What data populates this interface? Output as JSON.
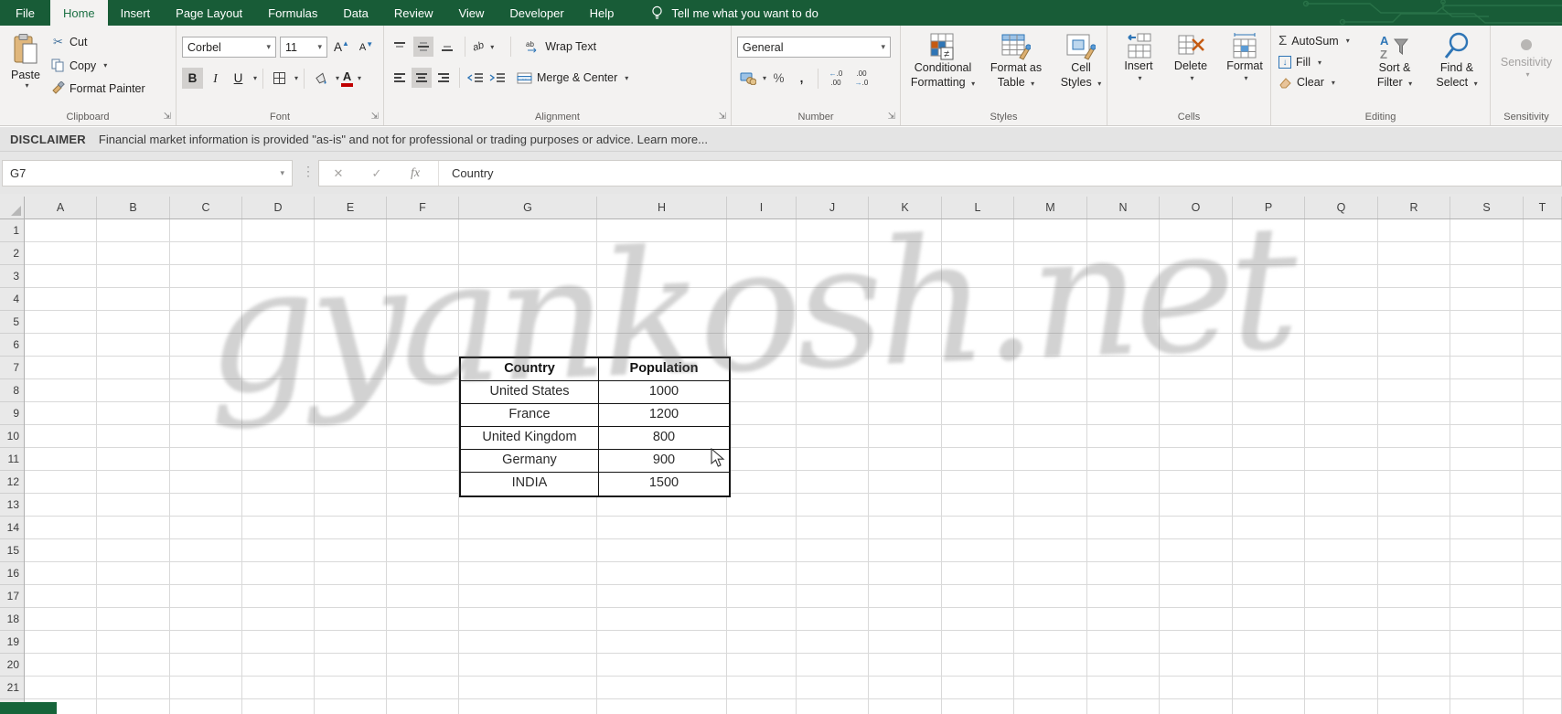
{
  "titlebar": {
    "file_tab": "File",
    "tabs": [
      "Home",
      "Insert",
      "Page Layout",
      "Formulas",
      "Data",
      "Review",
      "View",
      "Developer",
      "Help"
    ],
    "active_tab": "Home",
    "tell_me": "Tell me what you want to do"
  },
  "ribbon": {
    "groups": {
      "clipboard": {
        "label": "Clipboard",
        "paste": "Paste",
        "cut": "Cut",
        "copy": "Copy",
        "format_painter": "Format Painter"
      },
      "font": {
        "label": "Font",
        "name": "Corbel",
        "size": "11",
        "bold": "B",
        "italic": "I",
        "underline": "U"
      },
      "alignment": {
        "label": "Alignment",
        "wrap": "Wrap Text",
        "merge": "Merge & Center"
      },
      "number": {
        "label": "Number",
        "format": "General"
      },
      "styles": {
        "label": "Styles",
        "conditional": "Conditional Formatting",
        "format_table": "Format as Table",
        "cell_styles": "Cell Styles"
      },
      "cells": {
        "label": "Cells",
        "insert": "Insert",
        "delete": "Delete",
        "format": "Format"
      },
      "editing": {
        "label": "Editing",
        "autosum": "AutoSum",
        "fill": "Fill",
        "clear": "Clear",
        "sort_filter": "Sort & Filter",
        "find_select": "Find & Select"
      },
      "sensitivity": {
        "label": "Sensitivity",
        "button": "Sensitivity"
      }
    }
  },
  "icons": {
    "dropdown": "▾",
    "launcher": "⇲",
    "cut": "✂",
    "sigma": "Σ",
    "fill_arrow": "↓",
    "dots": "⋮",
    "cancel": "✕",
    "enter": "✓",
    "not_equal": "≠",
    "grow_font": "A",
    "shrink_font": "A",
    "font_color_letter": "A",
    "orientation": "ab",
    "merge_arrows": "↔",
    "percent": "%",
    "comma": ",",
    "inc_decimal_top": "←.0",
    "inc_decimal_bottom": ".00",
    "dec_decimal_top": ".00",
    "dec_decimal_bottom": "→.0",
    "sort_a": "A",
    "sort_z": "Z"
  },
  "disclaimer": {
    "prefix": "DISCLAIMER",
    "text": "Financial market information is provided \"as-is\" and not for professional or trading purposes or advice. Learn more..."
  },
  "formula_bar": {
    "cell_ref": "G7",
    "formula": "Country",
    "fx": "fx"
  },
  "sheet": {
    "column_headers": [
      "A",
      "B",
      "C",
      "D",
      "E",
      "F",
      "G",
      "H",
      "I",
      "J",
      "K",
      "L",
      "M",
      "N",
      "O",
      "P",
      "Q",
      "R",
      "S",
      "T"
    ],
    "row_headers": [
      "1",
      "2",
      "3",
      "4",
      "5",
      "6",
      "7",
      "8",
      "9",
      "10",
      "11",
      "12",
      "13",
      "14",
      "15",
      "16",
      "17",
      "18",
      "19",
      "20",
      "21"
    ],
    "table": {
      "headers": [
        "Country",
        "Population"
      ],
      "rows": [
        [
          "United States",
          "1000"
        ],
        [
          "France",
          "1200"
        ],
        [
          "United Kingdom",
          "800"
        ],
        [
          "Germany",
          "900"
        ],
        [
          "INDIA",
          "1500"
        ]
      ]
    },
    "watermark": "gyankosh.net"
  },
  "colors": {
    "excel_green": "#185c37",
    "accent_green": "#217346",
    "ribbon_bg": "#f3f2f1"
  }
}
